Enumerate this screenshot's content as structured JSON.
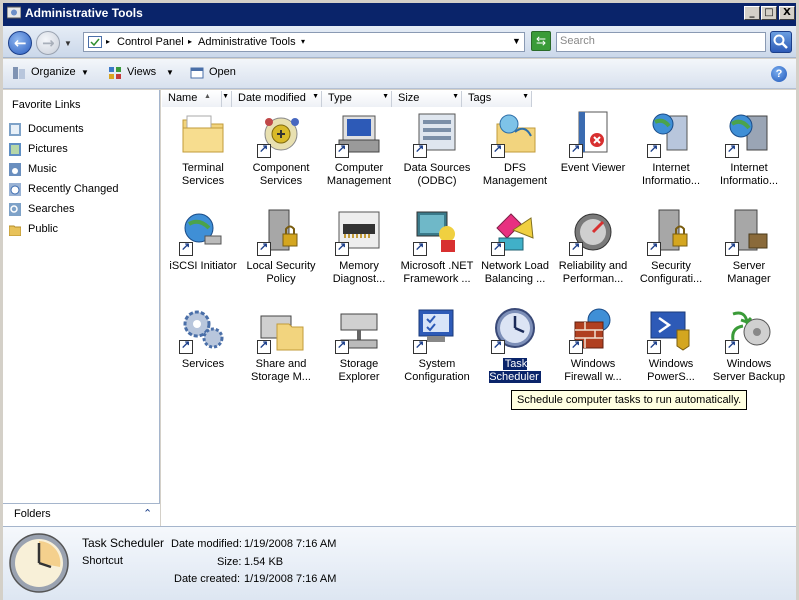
{
  "window": {
    "title": "Administrative Tools",
    "minimize": "_",
    "maximize": "□",
    "close": "X"
  },
  "address": {
    "crumbs": [
      "Control Panel",
      "Administrative Tools"
    ],
    "search_placeholder": "Search"
  },
  "toolbar": {
    "organize": "Organize",
    "views": "Views",
    "open": "Open",
    "help": "?"
  },
  "nav": {
    "heading": "Favorite Links",
    "items": [
      "Documents",
      "Pictures",
      "Music",
      "Recently Changed",
      "Searches",
      "Public"
    ],
    "folders": "Folders"
  },
  "columns": [
    "Name",
    "Date modified",
    "Type",
    "Size",
    "Tags"
  ],
  "items": [
    {
      "label": "Terminal Services",
      "icon": "folder-icon"
    },
    {
      "label": "Component Services",
      "icon": "component-services-icon"
    },
    {
      "label": "Computer Management",
      "icon": "computer-management-icon"
    },
    {
      "label": "Data Sources (ODBC)",
      "icon": "data-sources-icon"
    },
    {
      "label": "DFS Management",
      "icon": "dfs-management-icon"
    },
    {
      "label": "Event Viewer",
      "icon": "event-viewer-icon"
    },
    {
      "label": "Internet Informatio...",
      "icon": "iis-icon"
    },
    {
      "label": "Internet Informatio...",
      "icon": "iis6-icon"
    },
    {
      "label": "iSCSI Initiator",
      "icon": "iscsi-icon"
    },
    {
      "label": "Local Security Policy",
      "icon": "security-policy-icon"
    },
    {
      "label": "Memory Diagnost...",
      "icon": "memory-icon"
    },
    {
      "label": "Microsoft .NET Framework ...",
      "icon": "dotnet-icon"
    },
    {
      "label": "Network Load Balancing ...",
      "icon": "nlb-icon"
    },
    {
      "label": "Reliability and Performan...",
      "icon": "gauge-icon"
    },
    {
      "label": "Security Configurati...",
      "icon": "security-config-icon"
    },
    {
      "label": "Server Manager",
      "icon": "server-manager-icon"
    },
    {
      "label": "Services",
      "icon": "gears-icon"
    },
    {
      "label": "Share and Storage M...",
      "icon": "share-storage-icon"
    },
    {
      "label": "Storage Explorer",
      "icon": "storage-explorer-icon"
    },
    {
      "label": "System Configuration",
      "icon": "system-config-icon"
    },
    {
      "label": "Task Scheduler",
      "icon": "clock-icon"
    },
    {
      "label": "Windows Firewall w...",
      "icon": "firewall-icon"
    },
    {
      "label": "Windows PowerS...",
      "icon": "powershell-icon"
    },
    {
      "label": "Windows Server Backup",
      "icon": "backup-icon"
    }
  ],
  "tooltip": "Schedule computer tasks to run automatically.",
  "details": {
    "name": "Task Scheduler",
    "type": "Shortcut",
    "modified_label": "Date modified:",
    "modified_value": "1/19/2008 7:16 AM",
    "size_label": "Size:",
    "size_value": "1.54 KB",
    "created_label": "Date created:",
    "created_value": "1/19/2008 7:16 AM"
  }
}
